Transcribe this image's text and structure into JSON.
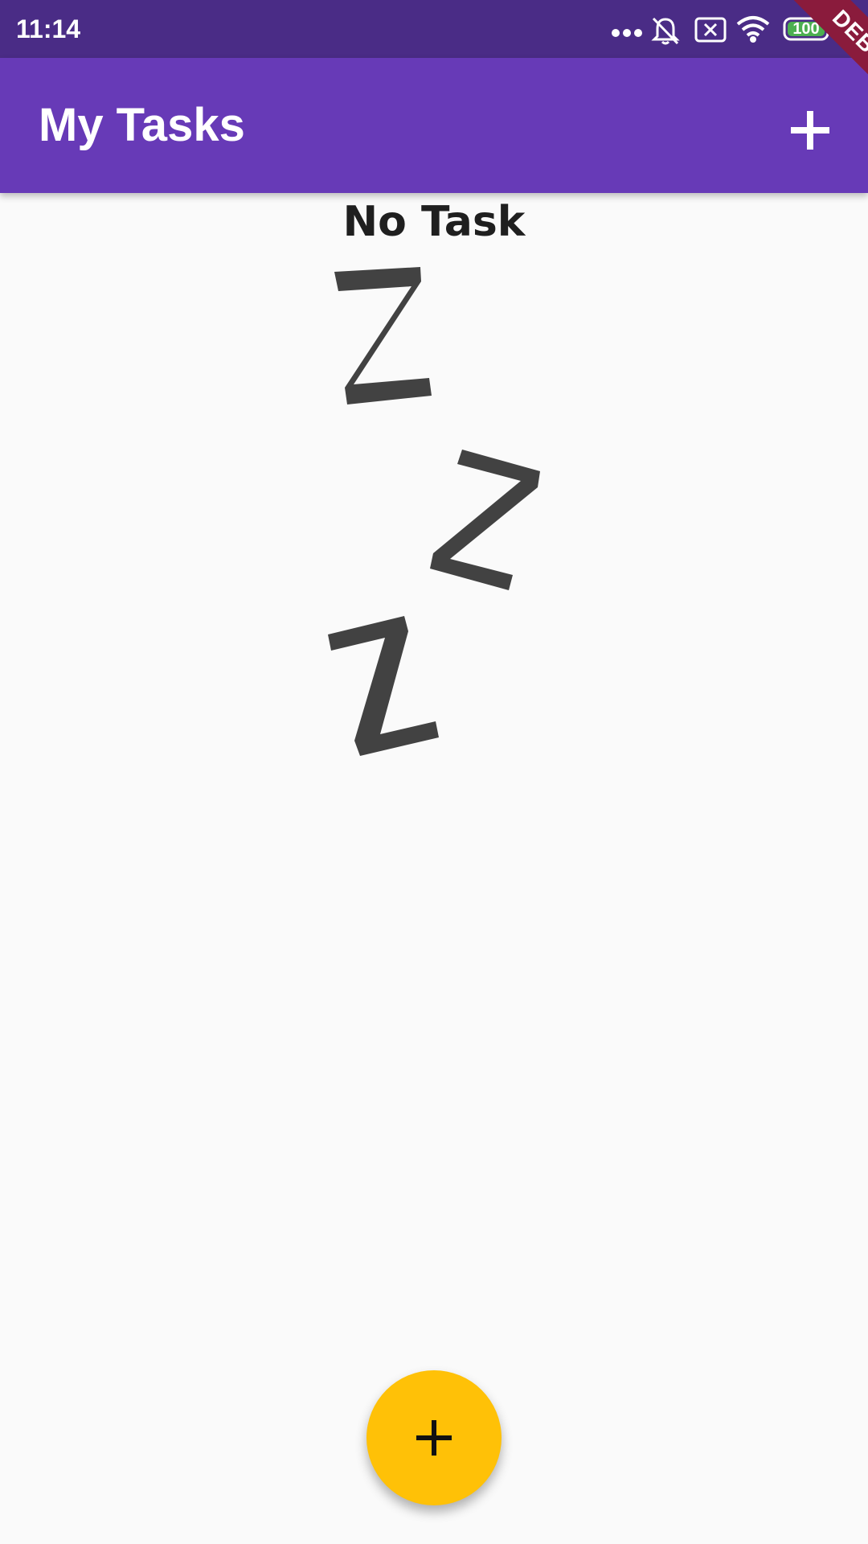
{
  "status_bar": {
    "time": "11:14",
    "battery": "100",
    "icons": [
      "more-dots-icon",
      "notifications-off-icon",
      "sim-error-icon",
      "wifi-icon",
      "battery-icon",
      "charging-icon"
    ]
  },
  "app_bar": {
    "title": "My Tasks",
    "action_icon": "add-icon"
  },
  "debug_banner": "DEBUG",
  "empty_state": {
    "title": "No Task",
    "illustration": "sleeping-zzz-icon"
  },
  "fab": {
    "icon": "add-icon"
  },
  "colors": {
    "status_bar": "#4a2c86",
    "app_bar": "#673ab7",
    "background": "#fafafa",
    "fab": "#ffc107",
    "debug_banner": "#8a1b3c",
    "zzz": "#424242",
    "battery_fill": "#4caf50"
  }
}
